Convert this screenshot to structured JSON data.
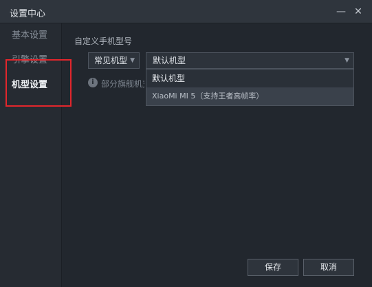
{
  "window": {
    "title": "设置中心",
    "minimize_glyph": "—",
    "close_glyph": "✕"
  },
  "sidebar": {
    "items": [
      {
        "label": "基本设置"
      },
      {
        "label": "引擎设置"
      },
      {
        "label": "机型设置",
        "active": true
      }
    ]
  },
  "main": {
    "section_label": "自定义手机型号",
    "model_type_select": {
      "value": "常见机型"
    },
    "model_select": {
      "value": "默认机型",
      "options": [
        "默认机型",
        "XiaoMi MI 5（支持王者高帧率）"
      ],
      "highlighted_index": 1
    },
    "info_text": "部分旗舰机支持"
  },
  "footer": {
    "save_label": "保存",
    "cancel_label": "取消"
  },
  "colors": {
    "background": "#22272e",
    "highlight_border": "#e3262c"
  }
}
